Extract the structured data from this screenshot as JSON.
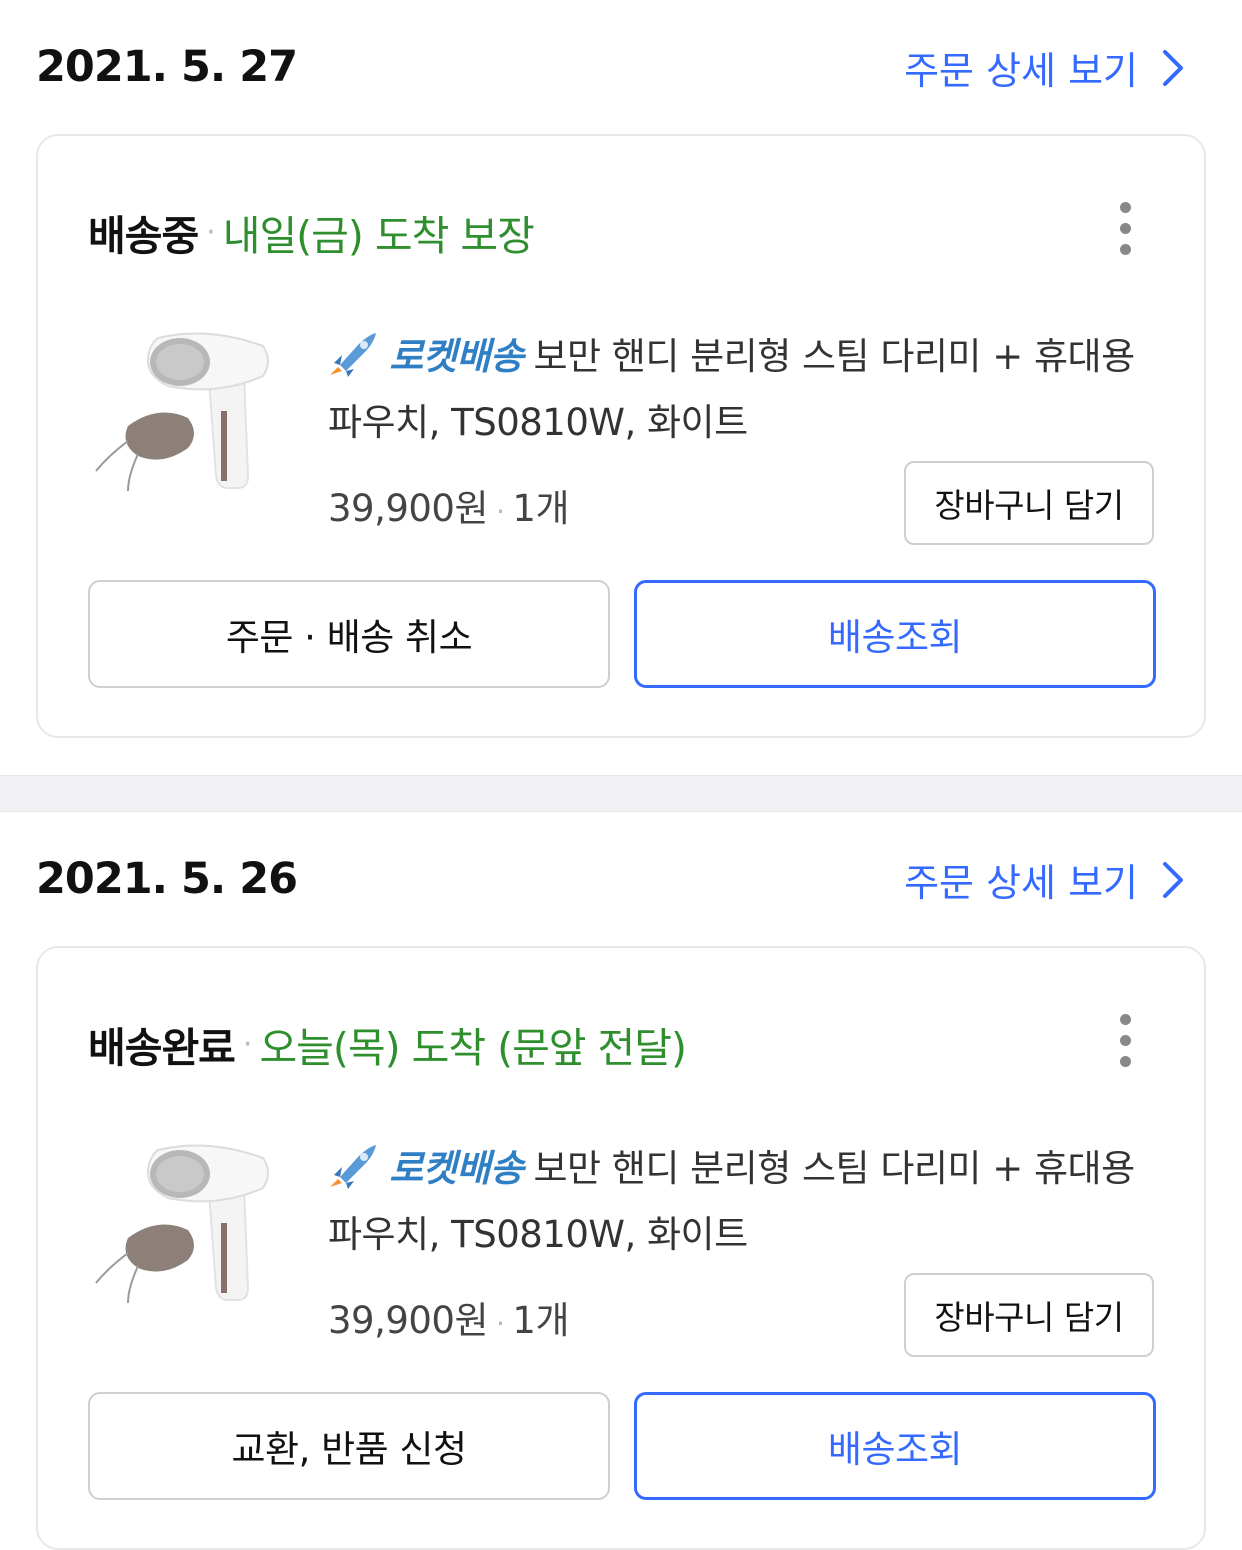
{
  "orders": [
    {
      "date": "2021. 5. 27",
      "detail_link": "주문 상세 보기",
      "status": "배송중",
      "status_detail": "내일(금) 도착 보장",
      "rocket_label": "로켓배송",
      "product_name": "보만 핸디 분리형 스팀 다리미 + 휴대용 파우치, TS0810W, 화이트",
      "price": "39,900원",
      "quantity": "1개",
      "cart_button": "장바구니 담기",
      "left_button": "주문 · 배송 취소",
      "right_button": "배송조회"
    },
    {
      "date": "2021. 5. 26",
      "detail_link": "주문 상세 보기",
      "status": "배송완료",
      "status_detail": "오늘(목) 도착 (문앞 전달)",
      "rocket_label": "로켓배송",
      "product_name": "보만 핸디 분리형 스팀 다리미 + 휴대용 파우치, TS0810W, 화이트",
      "price": "39,900원",
      "quantity": "1개",
      "cart_button": "장바구니 담기",
      "left_button": "교환, 반품 신청",
      "right_button": "배송조회"
    }
  ],
  "colors": {
    "link_blue": "#346aff",
    "status_green": "#2f8f2f",
    "rocket_blue": "#2f7fc4"
  },
  "icons": [
    "chevron-right-icon",
    "kebab-menu-icon",
    "rocket-icon",
    "product-thumbnail"
  ]
}
